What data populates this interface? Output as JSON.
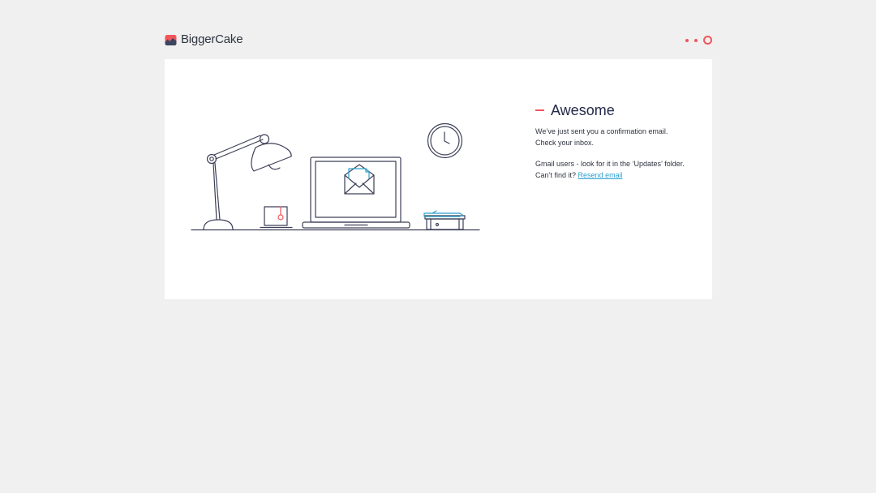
{
  "header": {
    "brand": "BiggerCake",
    "steps": [
      "step-1",
      "step-2",
      "step-3"
    ],
    "active_step": 3
  },
  "message": {
    "title": "Awesome",
    "line1": "We’ve just sent you a confirmation email.",
    "line2": "Check your inbox.",
    "line3": "Gmail users - look for it in the ‘Updates’ folder.",
    "line4_prefix": "Can’t find it?",
    "resend_label": "Resend email"
  },
  "colors": {
    "background": "#f0f0f0",
    "card": "#ffffff",
    "accent": "#f2555a",
    "link": "#2ca0cf",
    "ink": "#3d4057",
    "title": "#252a48"
  }
}
